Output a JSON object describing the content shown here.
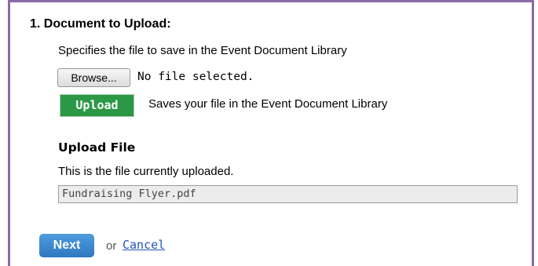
{
  "document_section": {
    "title": "1.  Document to Upload:",
    "description": "Specifies the file to save in the Event Document Library",
    "browse_label": "Browse...",
    "no_file_text": "No file selected.",
    "upload_label": "Upload",
    "upload_description": "Saves your file in the Event Document Library"
  },
  "upload_file_section": {
    "heading": "Upload File",
    "current_text": "This is the file currently uploaded.",
    "file_name": "Fundraising Flyer.pdf"
  },
  "actions": {
    "next_label": "Next",
    "or_text": "or",
    "cancel_label": "Cancel"
  },
  "colors": {
    "frame_border": "#8a6aa8",
    "upload_green": "#2a9845",
    "next_blue": "#3b86cf",
    "link_blue": "#2255bb"
  }
}
